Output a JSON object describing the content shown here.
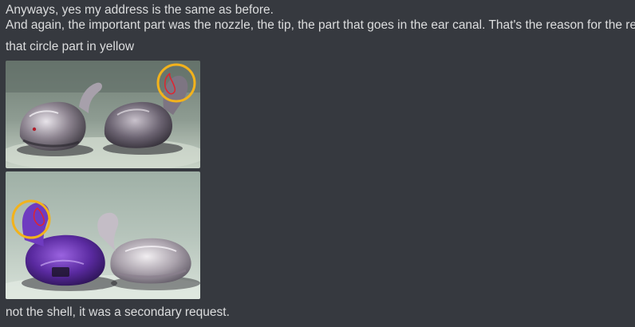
{
  "messages": [
    {
      "text": "Anyways, yes my address is the same as before."
    },
    {
      "text": "And again, the important part was the nozzle, the tip, the part that goes in the ear canal. That's the reason for the refit."
    },
    {
      "text": "that circle part in yellow"
    },
    {
      "text": "not the shell, it was a secondary request."
    }
  ],
  "attachments": [
    {
      "kind": "photo",
      "subject": "two clear in-ear monitor shells with nozzle circled in yellow"
    },
    {
      "kind": "photo",
      "subject": "purple and clear in-ear monitor shells with nozzle circled in yellow"
    }
  ],
  "colors": {
    "background": "#36393f",
    "text": "#dcddde",
    "highlight_circle": "#f2b21c",
    "annotation_red": "#e0242f"
  }
}
